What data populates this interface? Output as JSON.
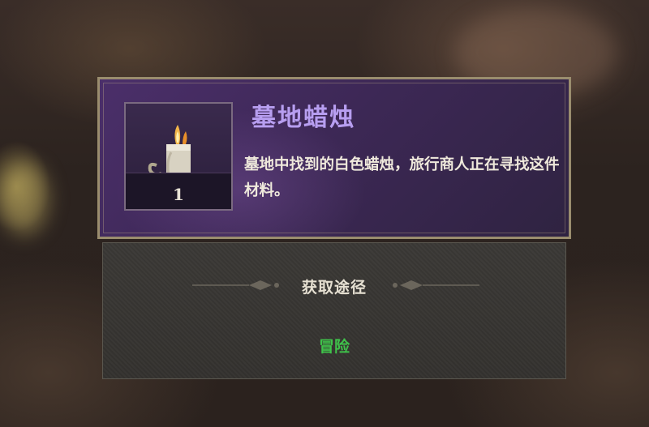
{
  "item": {
    "name": "墓地蜡烛",
    "count": "1",
    "description": "墓地中找到的白色蜡烛，旅行商人正在寻找这件材料。",
    "icon": "candle-icon"
  },
  "acquisition": {
    "title": "获取途径",
    "sources": [
      "冒险"
    ]
  },
  "colors": {
    "name_color": "#b79ef0",
    "source_color": "#3fc24a",
    "panel_header": "#4b2f6a",
    "panel_body": "#3b3936"
  }
}
